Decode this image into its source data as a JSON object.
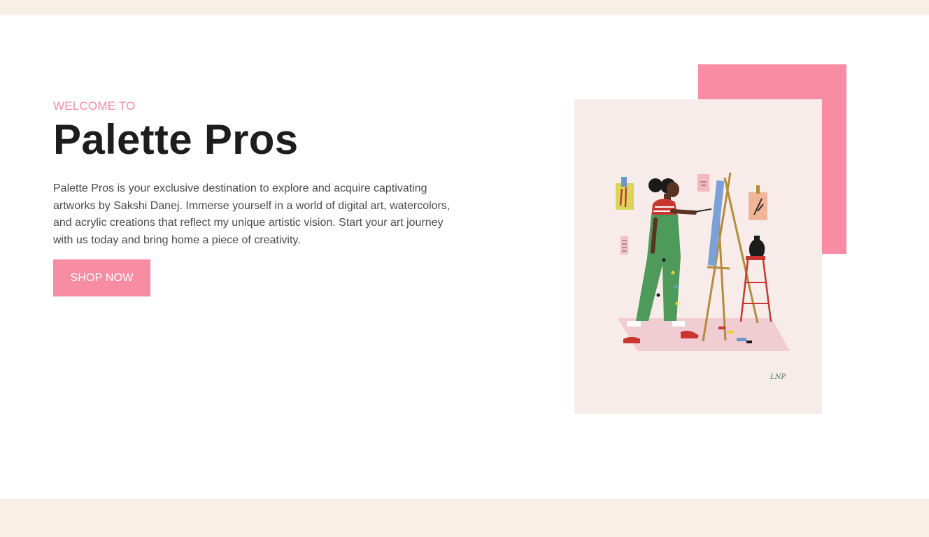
{
  "hero": {
    "eyebrow": "WELCOME TO",
    "title": "Palette Pros",
    "description": "Palette Pros is your exclusive destination to explore and acquire captivating artworks by Sakshi Danej. Immerse yourself in a world of digital art, watercolors, and acrylic creations that reflect my unique artistic vision. Start your art journey with us today and bring home a piece of creativity.",
    "cta_label": "SHOP NOW"
  },
  "illustration": {
    "subject": "woman painting at easel",
    "signature": "LNP"
  },
  "colors": {
    "accent": "#f78ca3",
    "band": "#f8efe5",
    "card": "#f7ecea",
    "title": "#1d1d1f",
    "body": "#4a4a4a"
  }
}
